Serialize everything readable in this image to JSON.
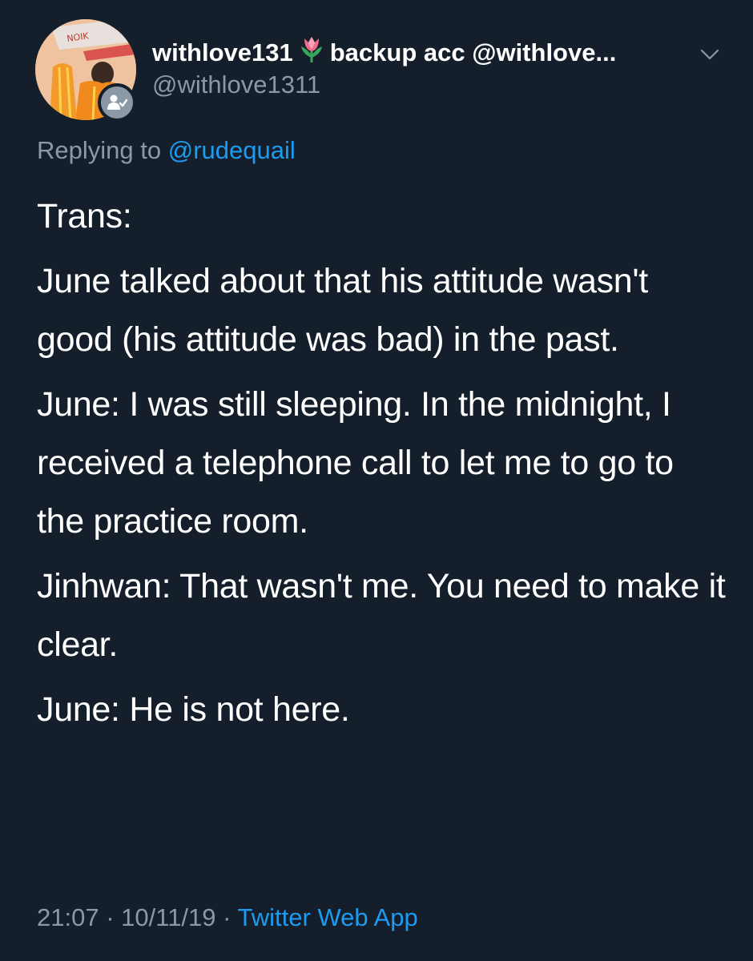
{
  "tweet": {
    "display_name": "withlove131",
    "name_suffix": "backup acc @withlove...",
    "handle": "@withlove1311",
    "avatar_text": "NOIK",
    "replying_prefix": "Replying to",
    "replying_to": "@rudequail",
    "paragraphs": [
      "Trans:",
      "June talked about that his attitude wasn't good (his attitude was bad) in the past.",
      "June: I was still sleeping. In the midnight, I received a telephone call to let me to go to the practice room.",
      "Jinhwan: That wasn't me. You need to make it clear.",
      "June: He is not here."
    ],
    "time": "21:07",
    "date": "10/11/19",
    "separator": "·",
    "source_app": "Twitter Web App"
  },
  "icons": {
    "name_emoji": "tulip-icon",
    "badge": "user-check-icon",
    "menu": "chevron-down-icon"
  },
  "colors": {
    "background": "#151f2b",
    "text": "#ffffff",
    "secondary": "#8b98a5",
    "accent": "#1d9bf0"
  }
}
